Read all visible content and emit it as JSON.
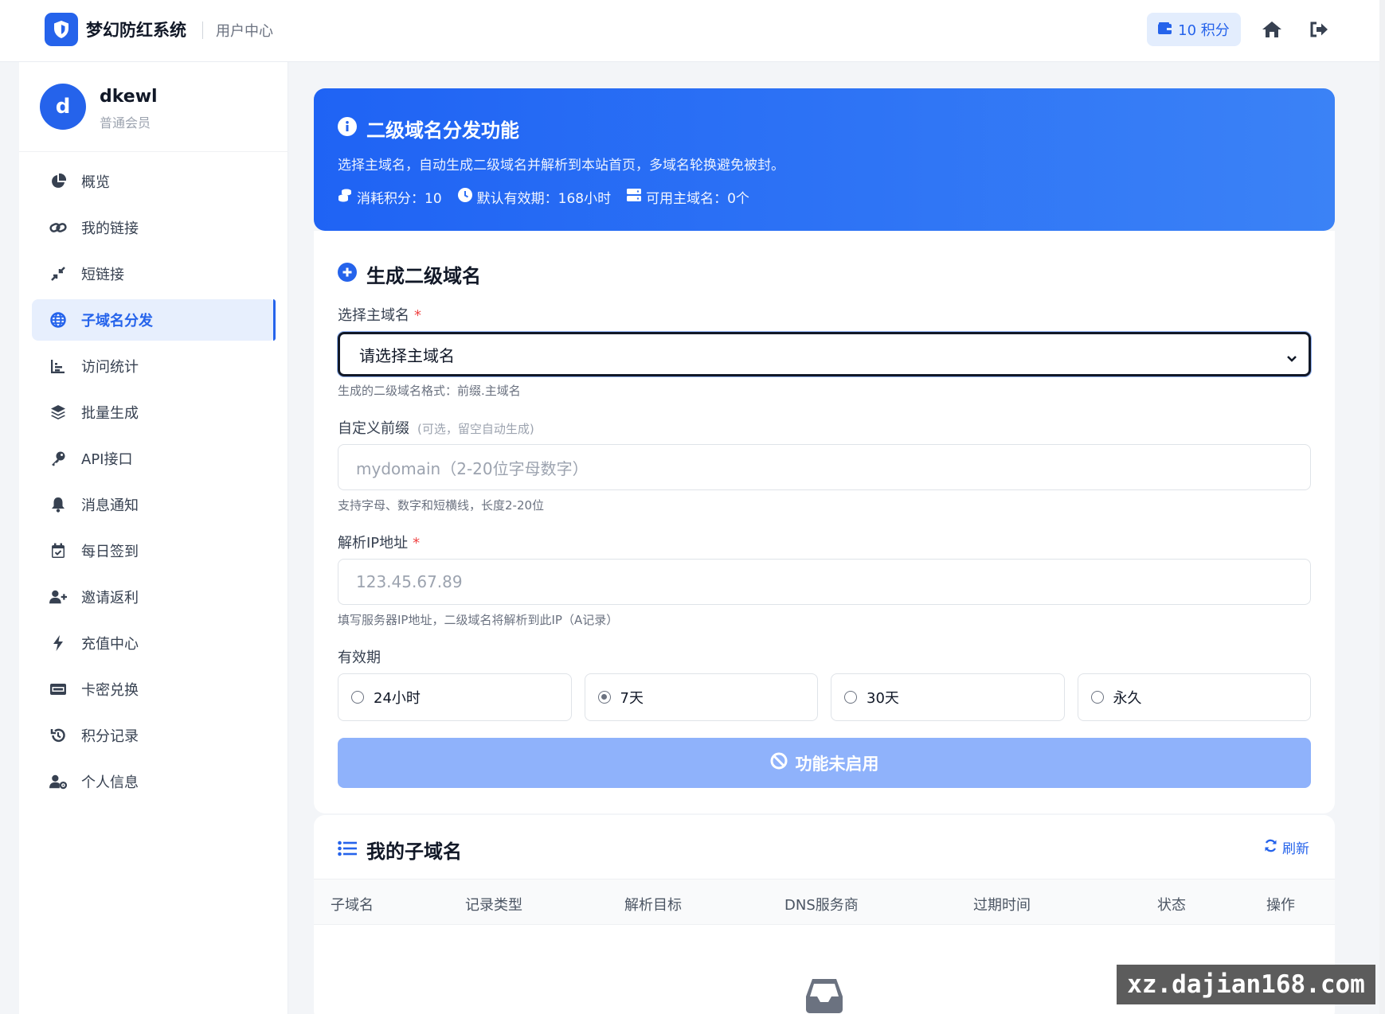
{
  "header": {
    "brand_name": "梦幻防红系统",
    "section": "用户中心",
    "points_badge": "10 积分"
  },
  "user": {
    "avatar_letter": "d",
    "name": "dkewl",
    "level": "普通会员"
  },
  "sidebar": {
    "items": [
      {
        "label": "概览",
        "icon": "pie-chart-icon"
      },
      {
        "label": "我的链接",
        "icon": "link-icon"
      },
      {
        "label": "短链接",
        "icon": "compress-icon"
      },
      {
        "label": "子域名分发",
        "icon": "globe-icon",
        "active": true
      },
      {
        "label": "访问统计",
        "icon": "bar-chart-icon"
      },
      {
        "label": "批量生成",
        "icon": "layers-icon"
      },
      {
        "label": "API接口",
        "icon": "key-icon"
      },
      {
        "label": "消息通知",
        "icon": "bell-icon"
      },
      {
        "label": "每日签到",
        "icon": "calendar-check-icon"
      },
      {
        "label": "邀请返利",
        "icon": "user-plus-icon"
      },
      {
        "label": "充值中心",
        "icon": "bolt-icon"
      },
      {
        "label": "卡密兑换",
        "icon": "card-icon"
      },
      {
        "label": "积分记录",
        "icon": "history-icon"
      },
      {
        "label": "个人信息",
        "icon": "user-gear-icon"
      }
    ]
  },
  "banner": {
    "title": "二级域名分发功能",
    "description": "选择主域名，自动生成二级域名并解析到本站首页，多域名轮换避免被封。",
    "stat_cost": "消耗积分：10",
    "stat_validity": "默认有效期：168小时",
    "stat_domains": "可用主域名：0个"
  },
  "form": {
    "title": "生成二级域名",
    "domain_label": "选择主域名",
    "required_mark": "*",
    "domain_selected": "请选择主域名",
    "domain_hint": "生成的二级域名格式：前缀.主域名",
    "prefix_label": "自定义前缀",
    "prefix_optional": "(可选，留空自动生成)",
    "prefix_placeholder": "mydomain（2-20位字母数字）",
    "prefix_hint": "支持字母、数字和短横线，长度2-20位",
    "ip_label": "解析IP地址",
    "ip_placeholder": "123.45.67.89",
    "ip_hint": "填写服务器IP地址，二级域名将解析到此IP（A记录）",
    "period_label": "有效期",
    "periods": [
      {
        "label": "24小时",
        "checked": false
      },
      {
        "label": "7天",
        "checked": true
      },
      {
        "label": "30天",
        "checked": false
      },
      {
        "label": "永久",
        "checked": false
      }
    ],
    "submit_label": "功能未启用"
  },
  "list": {
    "title": "我的子域名",
    "refresh_label": "刷新",
    "columns": [
      "子域名",
      "记录类型",
      "解析目标",
      "DNS服务商",
      "过期时间",
      "状态",
      "操作"
    ]
  },
  "watermark": "xz.dajian168.com",
  "colors": {
    "primary": "#2563eb",
    "banner_start": "#1f63f4",
    "banner_end": "#3b82f6",
    "disabled_button": "#8fb2fb",
    "required": "#ef4444"
  }
}
